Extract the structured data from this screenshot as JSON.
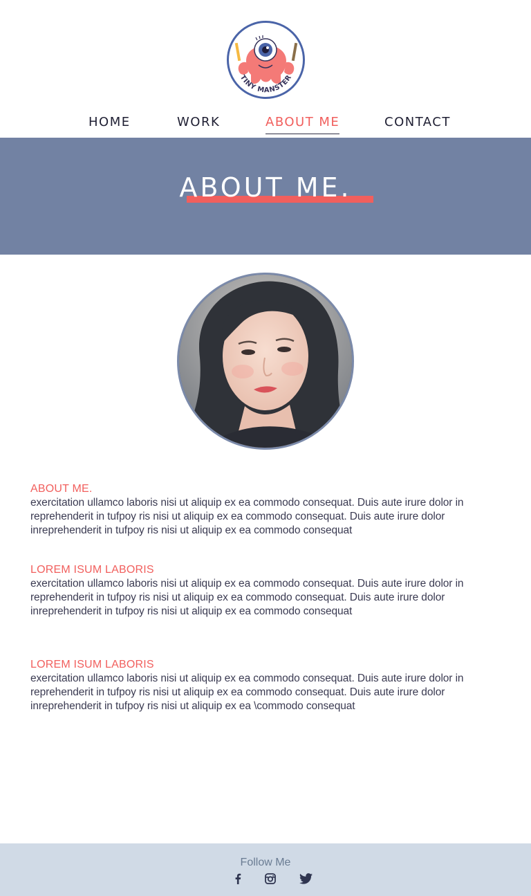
{
  "brand": {
    "logo_text": "TINY MANSTER"
  },
  "nav": {
    "items": [
      {
        "label": "HOME"
      },
      {
        "label": "WORK"
      },
      {
        "label": "ABOUT ME"
      },
      {
        "label": "CONTACT"
      }
    ],
    "active": "ABOUT ME"
  },
  "hero": {
    "title": "ABOUT ME."
  },
  "sections": [
    {
      "heading": "ABOUT ME.",
      "body": "exercitation ullamco laboris nisi ut aliquip ex ea commodo consequat. Duis aute irure dolor in reprehenderit in tufpoy ris nisi ut aliquip ex ea commodo consequat. Duis aute irure dolor inreprehenderit in tufpoy ris nisi ut aliquip ex ea commodo consequat"
    },
    {
      "heading": "LOREM ISUM LABORIS",
      "body": "exercitation ullamco laboris nisi ut aliquip ex ea commodo consequat. Duis aute irure dolor in reprehenderit in tufpoy ris nisi ut aliquip ex ea commodo consequat. Duis aute irure dolor inreprehenderit in tufpoy ris nisi ut aliquip ex ea commodo consequat"
    },
    {
      "heading": "LOREM ISUM LABORIS",
      "body": "exercitation ullamco laboris nisi ut aliquip ex ea commodo consequat. Duis aute irure dolor in reprehenderit in tufpoy ris nisi ut aliquip ex ea commodo consequat. Duis aute irure dolor inreprehenderit in tufpoy ris nisi ut aliquip ex ea \\commodo consequat"
    }
  ],
  "footer": {
    "follow_label": "Follow Me",
    "social": [
      {
        "icon": "facebook-icon"
      },
      {
        "icon": "instagram-icon"
      },
      {
        "icon": "twitter-icon"
      }
    ]
  },
  "colors": {
    "accent": "#f15f5d",
    "hero_bg": "#7282a3",
    "footer_bg": "#d0dae6",
    "text": "#2f2f45"
  }
}
